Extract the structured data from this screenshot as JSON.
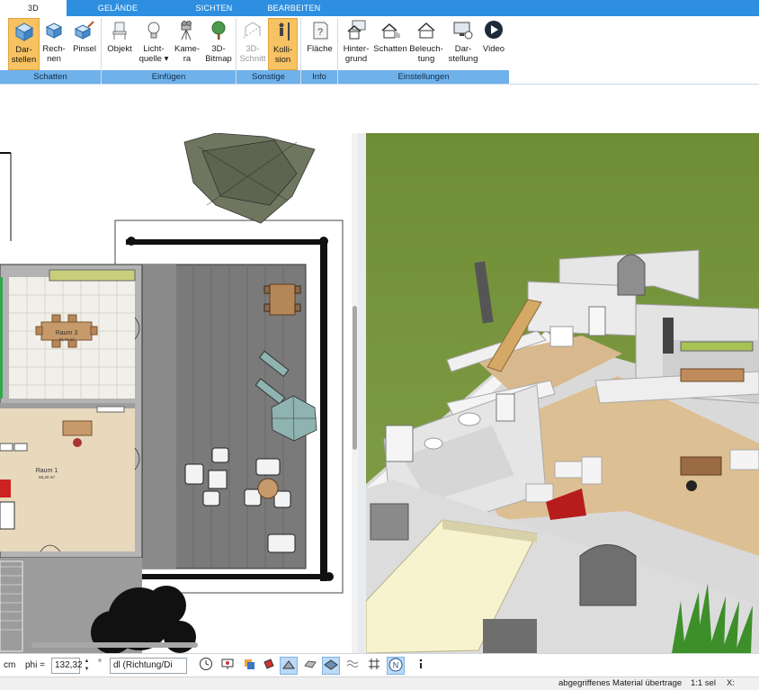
{
  "ribbon": {
    "tabs": [
      {
        "label": "3D",
        "active": true
      },
      {
        "label": "GELÄNDE",
        "active": false
      },
      {
        "label": "SICHTEN",
        "active": false
      },
      {
        "label": "BEARBEITEN",
        "active": false
      }
    ],
    "buttons": [
      {
        "line1": "Dar-",
        "line2": "stellen",
        "icon": "cube-render-icon",
        "selected": true
      },
      {
        "line1": "Rech-",
        "line2": "nen",
        "icon": "cube-calc-icon"
      },
      {
        "line1": "Pinsel",
        "line2": "",
        "icon": "paint-cube-icon"
      },
      {
        "line1": "Objekt",
        "line2": "",
        "icon": "chair-icon"
      },
      {
        "line1": "Licht-",
        "line2": "quelle ▾",
        "icon": "light-bulb-icon"
      },
      {
        "line1": "Kame-",
        "line2": "ra",
        "icon": "camera-icon"
      },
      {
        "line1": "3D-",
        "line2": "Bitmap",
        "icon": "tree-bitmap-icon"
      },
      {
        "line1": "3D-",
        "line2": "Schnitt",
        "icon": "section-cut-icon",
        "disabled": true
      },
      {
        "line1": "Kolli-",
        "line2": "sion",
        "icon": "collision-person-icon",
        "selected": true
      },
      {
        "line1": "Fläche",
        "line2": "",
        "icon": "area-info-icon"
      },
      {
        "line1": "Hinter-",
        "line2": "grund",
        "icon": "house-background-icon"
      },
      {
        "line1": "Schatten",
        "line2": "",
        "icon": "house-shadow-icon"
      },
      {
        "line1": "Beleuch-",
        "line2": "tung",
        "icon": "house-lighting-icon"
      },
      {
        "line1": "Dar-",
        "line2": "stellung",
        "icon": "display-settings-icon"
      },
      {
        "line1": "Video",
        "line2": "",
        "icon": "video-play-icon"
      }
    ],
    "groups": [
      "Schatten",
      "Einfügen",
      "Sonstige",
      "Info",
      "Einstellungen"
    ]
  },
  "plan": {
    "room3_name": "Raum 3",
    "room3_area": "40,47 m²",
    "room1_name": "Raum 1",
    "room1_area": "66,20 m²"
  },
  "bottombar": {
    "unit": "cm",
    "phi_label": "phi =",
    "phi_value": "132,32",
    "degree": "°",
    "dl_select": "dl (Richtung/Di"
  },
  "status": {
    "message": "abgegriffenes Material übertrage",
    "scale": "1:1 sel",
    "x_label": "X:"
  },
  "colors": {
    "ribbon_tab_bar": "#2e8fe0",
    "group_label_bg": "#6fb1ea",
    "selected_button": "#f7c262",
    "lawn": "#7d9a3e"
  }
}
